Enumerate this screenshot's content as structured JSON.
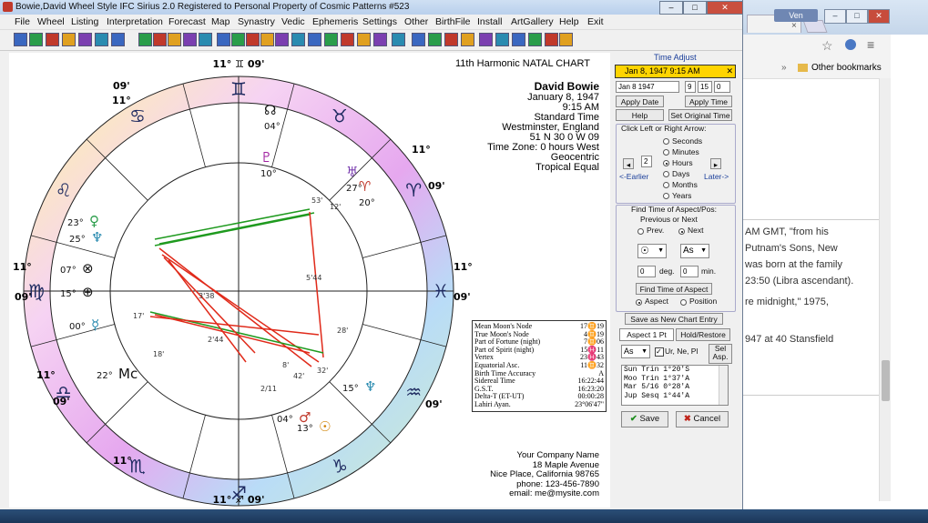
{
  "browser": {
    "user_label": "Ven",
    "tab_close": "×",
    "bookmarks_label": "Other bookmarks",
    "paragraphs": [
      "AM GMT, \"from his",
      "Putnam's Sons, New",
      "was born at the family",
      "23:50 (Libra ascendant).",
      "re midnight,\" 1975,",
      "947 at 40 Stansfield"
    ]
  },
  "app": {
    "title": "Bowie,David Wheel Style IFC       Sirius 2.0    Registered to Personal Property of Cosmic Patterns #523",
    "window_controls": {
      "minimize": "–",
      "maximize": "□",
      "close": "✕"
    },
    "menu": [
      "File",
      "Wheel",
      "Listing",
      "Interpretation",
      "Forecast",
      "Map",
      "Synastry",
      "Vedic",
      "Ephemeris",
      "Settings",
      "Other",
      "BirthFile",
      "Install",
      "ArtGallery",
      "Help",
      "Exit"
    ]
  },
  "chart": {
    "heading": "11th Harmonic NATAL CHART",
    "name": "David Bowie",
    "info_lines": [
      "January 8, 1947",
      "9:15 AM",
      "Standard Time",
      "Westminster, England",
      "51 N 30    0 W 09",
      "Time Zone: 0 hours West",
      "Geocentric",
      "Tropical Equal"
    ],
    "cusp_labels": {
      "top": "11° ♊ 09'",
      "bottom": "11° ♐ 09'",
      "left_top": "11°",
      "left_bot": "09'",
      "right_top": "11°",
      "right_bot": "09'"
    },
    "side_cusps": [
      {
        "deg": "09'"
      },
      {
        "deg": "11°"
      },
      {
        "deg": "11°"
      },
      {
        "deg": "09'"
      },
      {
        "deg": "11°"
      },
      {
        "deg": "09'"
      },
      {
        "deg": "11°"
      },
      {
        "deg": "09'"
      }
    ],
    "planets": [
      {
        "glyph": "☊",
        "deg": "04°"
      },
      {
        "glyph": "♇",
        "deg": "10°"
      },
      {
        "glyph": "♅",
        "deg": "27°"
      },
      {
        "glyph": "♈",
        "deg": "20°"
      },
      {
        "glyph": "♀",
        "deg": "23°"
      },
      {
        "glyph": "♆",
        "deg": "25°"
      },
      {
        "glyph": "⊗",
        "deg": "07°"
      },
      {
        "glyph": "⊕",
        "deg": "15°"
      },
      {
        "glyph": "☿",
        "deg": "00°"
      },
      {
        "glyph": "Mc",
        "deg": "22°"
      },
      {
        "glyph": "♆",
        "deg": "15°"
      },
      {
        "glyph": "♂",
        "deg": "04°"
      },
      {
        "glyph": "☉",
        "deg": "13°"
      }
    ],
    "inner_labels": [
      "53'",
      "12'",
      "28'",
      "5'44",
      "3'38",
      "2'44",
      "17'",
      "18'",
      "42'",
      "2/11",
      "32'",
      "8'"
    ],
    "table": [
      [
        "Mean Moon's Node",
        "17♊19"
      ],
      [
        "True Moon's Node",
        "4♊19"
      ],
      [
        "Part of Fortune (night)",
        "7♊06"
      ],
      [
        "Part of Spirit (night)",
        "15♓11"
      ],
      [
        "Vertex",
        "23♓43"
      ],
      [
        "Equatorial Asc.",
        "11♊32"
      ],
      [
        "Birth Time Accuracy",
        "A"
      ],
      [
        "Sidereal Time",
        "16:22:44"
      ],
      [
        "G.S.T.",
        "16:23:20"
      ],
      [
        "Delta-T (ET-UT)",
        "00:00:28"
      ],
      [
        "Lahiri Ayan.",
        "23°06'47\""
      ]
    ],
    "footer": [
      "Your Company Name",
      "18 Maple Avenue",
      "Nice Place, California 98765",
      "phone: 123-456-7890",
      "email: me@mysite.com"
    ]
  },
  "time_panel": {
    "title": "Time Adjust",
    "current": "Jan 8, 1947  9:15 AM",
    "date_value": "Jan 8 1947",
    "hour_value": "9",
    "min_value": "15",
    "sec_value": "0",
    "apply_date": "Apply Date",
    "apply_time": "Apply Time",
    "help": "Help",
    "set_original": "Set Original Time",
    "click_label": "Click Left or Right Arrow:",
    "step_value": "2",
    "units": [
      "Seconds",
      "Minutes",
      "Hours",
      "Days",
      "Months",
      "Years"
    ],
    "selected_unit": "Hours",
    "earlier": "<-Earlier",
    "later": "Later->",
    "find_title": "Find Time of Aspect/Pos:",
    "prev_next": "Previous or Next",
    "prev": "Prev.",
    "next": "Next",
    "planet1": "☉",
    "planet2": "As",
    "deg_value": "0",
    "deg_label": "deg.",
    "min_value2": "0",
    "min_label": "min.",
    "find_btn": "Find Time of Aspect",
    "aspect": "Aspect",
    "position": "Position",
    "save_new": "Save as New Chart Entry",
    "tab1": "Aspect 1 Pt",
    "tab2": "Hold/Restore",
    "as_sel": "As",
    "ur_ne": "Ur, Ne, Pl",
    "sel_asp": "Sel Asp.",
    "aspects": [
      "Sun Trin  1°20'S",
      "Moo Trin  1°37'A",
      "Mar 5/16  0°28'A",
      "Jup Sesq  1°44'A"
    ],
    "save": "Save",
    "cancel": "Cancel"
  },
  "colors": {
    "red_aspect": "#e02a1a",
    "green_aspect": "#1f9a1f",
    "accent": "#ffd400"
  }
}
